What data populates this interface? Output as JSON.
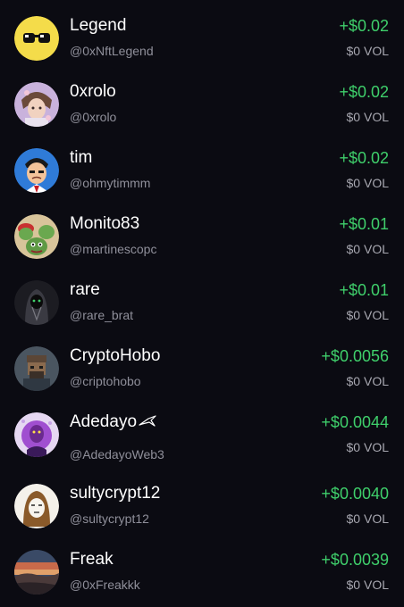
{
  "colors": {
    "background": "#0b0b12",
    "positive": "#3fcf6b",
    "handle": "#8f8f9a",
    "volume": "#a7a7b0"
  },
  "entries": [
    {
      "name": "Legend",
      "handle": "@0xNftLegend",
      "amount": "+$0.02",
      "volume": "$0 VOL",
      "avatar_icon": "sunglasses-face-icon"
    },
    {
      "name": "0xrolo",
      "handle": "@0xrolo",
      "amount": "+$0.02",
      "volume": "$0 VOL",
      "avatar_icon": "anime-character-icon"
    },
    {
      "name": "tim",
      "handle": "@ohmytimmm",
      "amount": "+$0.02",
      "volume": "$0 VOL",
      "avatar_icon": "cartoon-man-icon"
    },
    {
      "name": "Monito83",
      "handle": "@martinescopc",
      "amount": "+$0.01",
      "volume": "$0 VOL",
      "avatar_icon": "pepe-frogs-icon"
    },
    {
      "name": "rare",
      "handle": "@rare_brat",
      "amount": "+$0.01",
      "volume": "$0 VOL",
      "avatar_icon": "hooded-figure-icon"
    },
    {
      "name": "CryptoHobo",
      "handle": "@criptohobo",
      "amount": "+$0.0056",
      "volume": "$0 VOL",
      "avatar_icon": "pixel-hobo-icon"
    },
    {
      "name": "Adedayo",
      "handle": "@AdedayoWeb3",
      "amount": "+$0.0044",
      "volume": "$0 VOL",
      "avatar_icon": "purple-portrait-icon",
      "badge_icon": "bird-icon"
    },
    {
      "name": "sultycrypt12",
      "handle": "@sultycrypt12",
      "amount": "+$0.0040",
      "volume": "$0 VOL",
      "avatar_icon": "hooded-sketch-icon"
    },
    {
      "name": "Freak",
      "handle": "@0xFreakkk",
      "amount": "+$0.0039",
      "volume": "$0 VOL",
      "avatar_icon": "sunset-landscape-icon"
    }
  ]
}
